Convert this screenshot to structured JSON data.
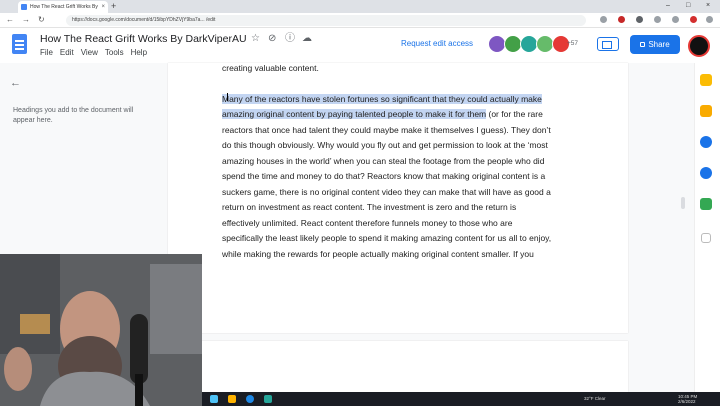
{
  "browser": {
    "tab_title": "How The React Grift Works By D",
    "tab_close": "×",
    "new_tab": "+",
    "url": "https://docs.google.com/document/d/15ibpYDhZVjY9ba7a... /edit",
    "window_controls": [
      "–",
      "□",
      "×"
    ]
  },
  "doc": {
    "title": "How The React Grift Works By DarkViperAU",
    "menu": [
      "File",
      "Edit",
      "View",
      "Tools",
      "Help"
    ],
    "request_edit": "Request edit access",
    "viewers_more": "+57",
    "share_label": "Share"
  },
  "sidebar": {
    "back": "←",
    "outline_hint": "Headings you add to the document will appear here."
  },
  "page": {
    "line0": "creating valuable content.",
    "line1_hl": "Many of the reactors have stolen fortunes so significant that they could actually make",
    "line2_hl": "amazing original content by paying talented people to make it for them",
    "line2_rest": " (or for the rare",
    "line3": "reactors that once had talent they could maybe make it themselves I guess). They don’t",
    "line4": "do this though obviously. Why would you fly out and get permission to look at the ‘most",
    "line5": "amazing houses in the world’ when you can steal the footage from the people who did",
    "line6": "spend the time and money to do that? Reactors know that making original content is a",
    "line7": "suckers game, there is no original content video they can make that will have as good a",
    "line8": "return on investment as react content. The investment is zero and the return is",
    "line9": "effectively unlimited. React content therefore funnels money to those who are",
    "line10": "specifically the least likely people to spend it making amazing content for us all to enjoy,",
    "line11": "while making the rewards for people actually making original content smaller. If you"
  },
  "taskbar": {
    "weather": "32°F Clear",
    "time": "10:45 PM",
    "date": "2/6/2022"
  },
  "colors": {
    "accent": "#1a73e8",
    "highlight": "#c3d5f2"
  }
}
